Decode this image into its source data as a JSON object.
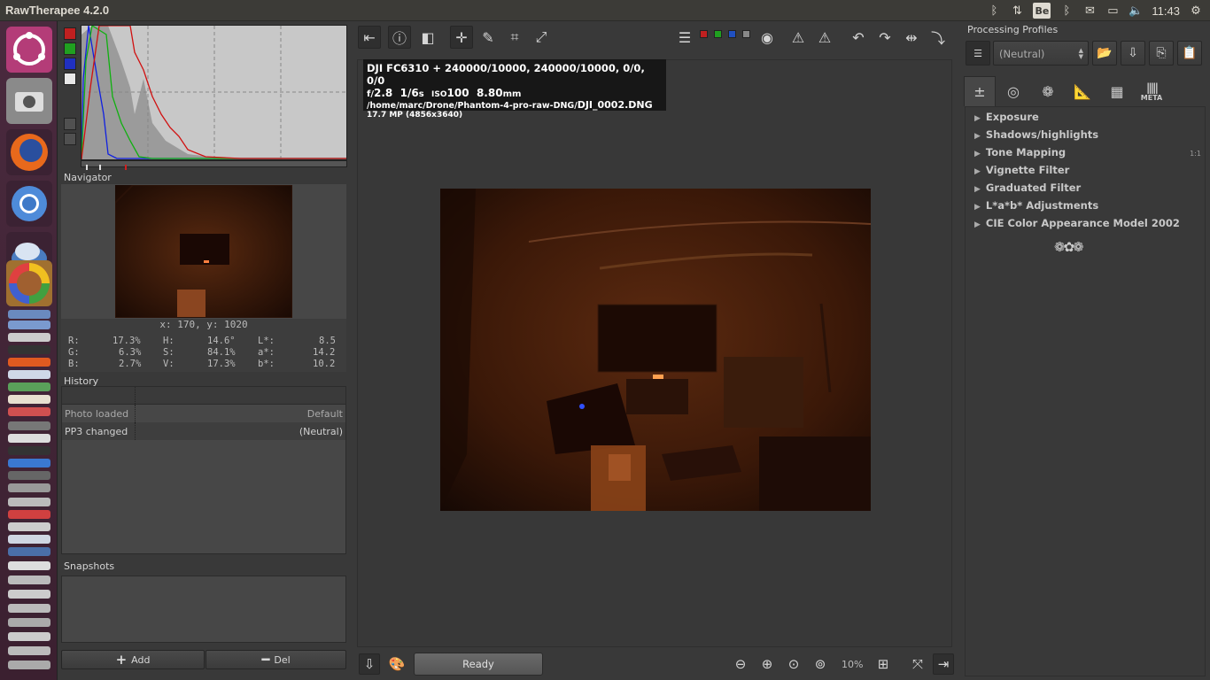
{
  "window": {
    "title": "RawTherapee 4.2.0"
  },
  "tray": {
    "be_label": "Be",
    "clock": "11:43"
  },
  "left": {
    "navigator_title": "Navigator",
    "coords": "x: 170, y: 1020",
    "values": {
      "r_label": "R:",
      "r": "17.3%",
      "g_label": "G:",
      "g": "6.3%",
      "b_label": "B:",
      "b": "2.7%",
      "h_label": "H:",
      "h": "14.6°",
      "s_label": "S:",
      "s": "84.1%",
      "v_label": "V:",
      "v": "17.3%",
      "l_label": "L*:",
      "l": "8.5",
      "a_label": "a*:",
      "a": "14.2",
      "bb_label": "b*:",
      "bb": "10.2"
    },
    "history_title": "History",
    "history": [
      {
        "action": "Photo loaded",
        "value": "Default"
      },
      {
        "action": "PP3 changed",
        "value": "(Neutral)"
      }
    ],
    "snapshots_title": "Snapshots",
    "add_label": "Add",
    "del_label": "Del"
  },
  "info": {
    "line1": "DJI FC6310 + 240000/10000, 240000/10000, 0/0, 0/0",
    "fnum_prefix": "f/",
    "fnum": "2.8",
    "shutter": "1/6",
    "shutter_unit": "s",
    "iso_label": "ISO",
    "iso": "100",
    "focal": "8.80",
    "focal_unit": "mm",
    "path_prefix": "/home/marc/Drone/Phantom-4-pro-raw-DNG/",
    "filename": "DJI_0002.DNG",
    "line4": "17.7 MP (4856x3640)"
  },
  "status": {
    "ready": "Ready",
    "zoom": "10%"
  },
  "right": {
    "profiles_title": "Processing Profiles",
    "profile_selected": "(Neutral)",
    "meta_tab": "META",
    "tools": [
      "Exposure",
      "Shadows/highlights",
      "Tone Mapping",
      "Vignette Filter",
      "Graduated Filter",
      "L*a*b* Adjustments",
      "CIE Color Appearance Model 2002"
    ],
    "tone_mapping_badge": "1:1"
  }
}
